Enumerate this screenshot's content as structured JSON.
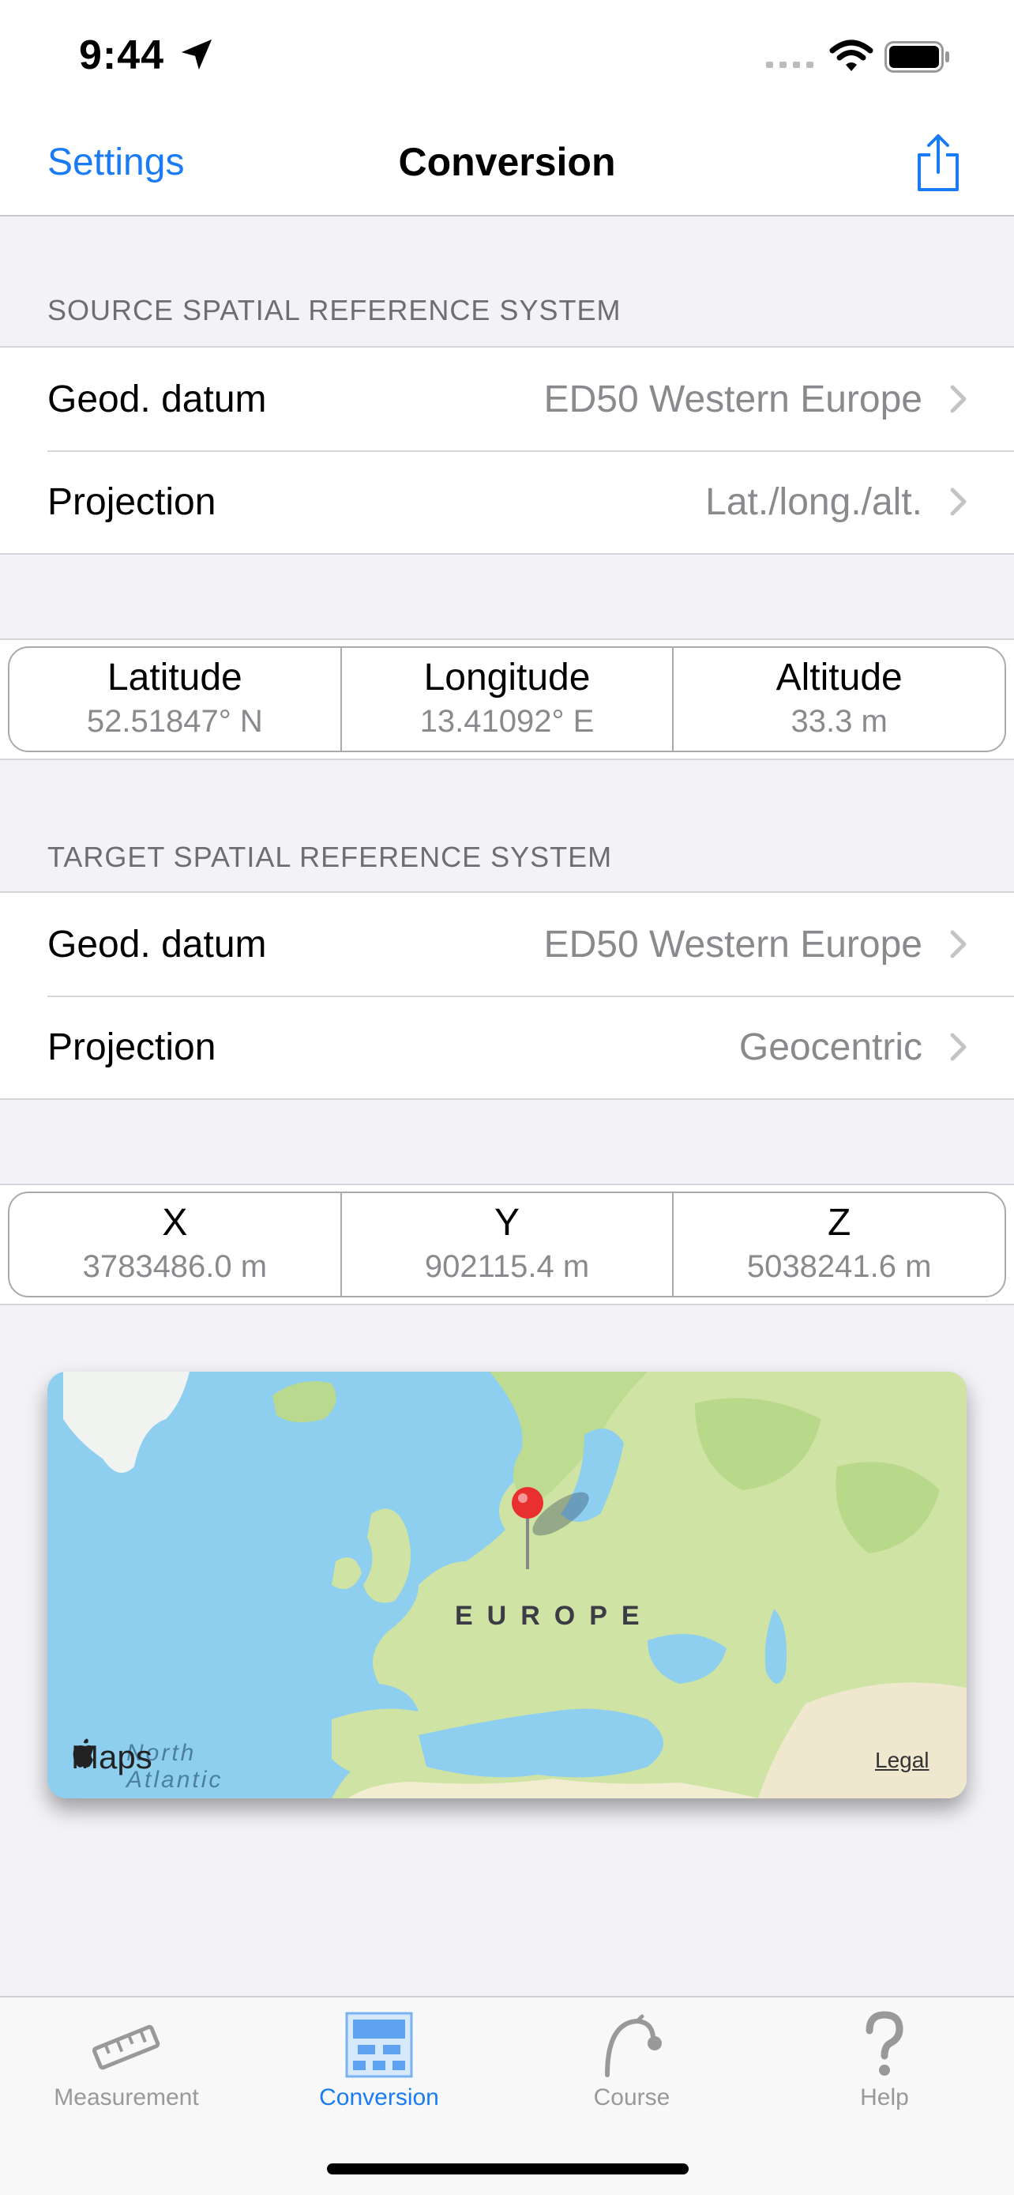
{
  "status": {
    "time": "9:44"
  },
  "nav": {
    "back": "Settings",
    "title": "Conversion"
  },
  "source": {
    "header": "SOURCE SPATIAL REFERENCE SYSTEM",
    "rows": [
      {
        "label": "Geod. datum",
        "value": "ED50 Western Europe"
      },
      {
        "label": "Projection",
        "value": "Lat./long./alt."
      }
    ],
    "coords": [
      {
        "label": "Latitude",
        "value": "52.51847° N"
      },
      {
        "label": "Longitude",
        "value": "13.41092° E"
      },
      {
        "label": "Altitude",
        "value": "33.3 m"
      }
    ]
  },
  "target": {
    "header": "TARGET SPATIAL REFERENCE SYSTEM",
    "rows": [
      {
        "label": "Geod. datum",
        "value": "ED50 Western Europe"
      },
      {
        "label": "Projection",
        "value": "Geocentric"
      }
    ],
    "coords": [
      {
        "label": "X",
        "value": "3783486.0 m"
      },
      {
        "label": "Y",
        "value": "902115.4 m"
      },
      {
        "label": "Z",
        "value": "5038241.6 m"
      }
    ]
  },
  "map": {
    "region_label": "EUROPE",
    "ocean_label_1": "North",
    "ocean_label_2": "Atlantic",
    "logo": "Maps",
    "legal": "Legal",
    "pin_color": "#e8312f"
  },
  "tabs": [
    {
      "label": "Measurement",
      "icon": "ruler-icon",
      "active": false
    },
    {
      "label": "Conversion",
      "icon": "conversion-icon",
      "active": true
    },
    {
      "label": "Course",
      "icon": "course-icon",
      "active": false
    },
    {
      "label": "Help",
      "icon": "help-icon",
      "active": false
    }
  ],
  "colors": {
    "accent": "#1a7cf5",
    "secondary_text": "#8a8a8e",
    "background": "#f2f2f7"
  }
}
